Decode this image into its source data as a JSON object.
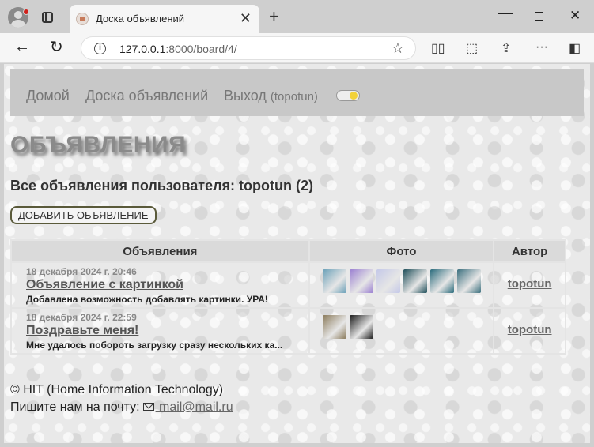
{
  "browser": {
    "tab_title": "Доска объявлений",
    "url_host": "127.0.0.1",
    "url_path": ":8000/board/4/"
  },
  "nav": {
    "home": "Домой",
    "board": "Доска объявлений",
    "logout": "Выход",
    "username": "(topotun)"
  },
  "page": {
    "heading": "ОБЪЯВЛЕНИЯ",
    "subheading": "Все объявления пользователя: topotun (2)",
    "add_button": "ДОБАВИТЬ ОБЪЯВЛЕНИЕ"
  },
  "table": {
    "headers": [
      "Объявления",
      "Фото",
      "Автор"
    ],
    "rows": [
      {
        "date": "18 декабря 2024 г. 20:46",
        "title": "Объявление с картинкой",
        "text": "Добавлена возможность добавлять картинки. УРА!",
        "author": "topotun",
        "photos": [
          "#6aa0b8",
          "#9a7fd1",
          "#c4c8e8",
          "#1f4f5a",
          "#2a6b7c",
          "#3b6f7e"
        ]
      },
      {
        "date": "18 декабря 2024 г. 22:59",
        "title": "Поздравьте меня!",
        "text": "Мне удалось побороть загрузку сразу нескольких ка...",
        "author": "topotun",
        "photos": [
          "#8a7a5a",
          "#1a1a1a"
        ]
      }
    ]
  },
  "footer": {
    "copyright": "© HIT (Home Information Technology)",
    "contact_prefix": "Пишите нам на почту:",
    "email": " mail@mail.ru"
  }
}
